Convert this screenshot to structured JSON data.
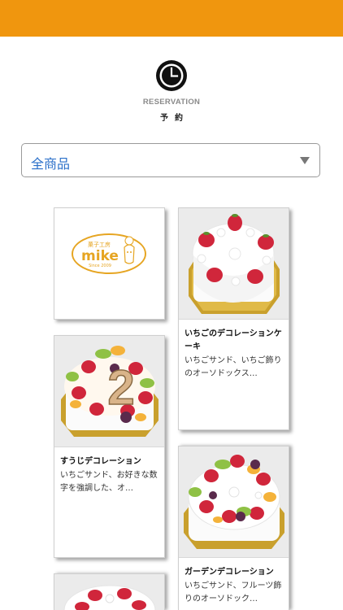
{
  "header": {
    "accent_color": "#f0960e"
  },
  "hero": {
    "icon": "clock-icon",
    "title_en": "RESERVATION",
    "title_ja": "予約"
  },
  "filter": {
    "selected": "全商品",
    "icon": "caret-down-icon"
  },
  "logo": {
    "top_text": "菓子工房",
    "brand": "mike",
    "since": "Since 2009"
  },
  "products": [
    {
      "title": "いちごのデコレーションケーキ",
      "desc": "いちごサンド、いちご飾りのオーソドックス…"
    },
    {
      "title": "すうじデコレーション",
      "desc": "いちごサンド、お好きな数字を強調した、オ…"
    },
    {
      "title": "ガーデンデコレーション",
      "desc": "いちごサンド、フルーツ飾りのオーソドック…"
    }
  ]
}
